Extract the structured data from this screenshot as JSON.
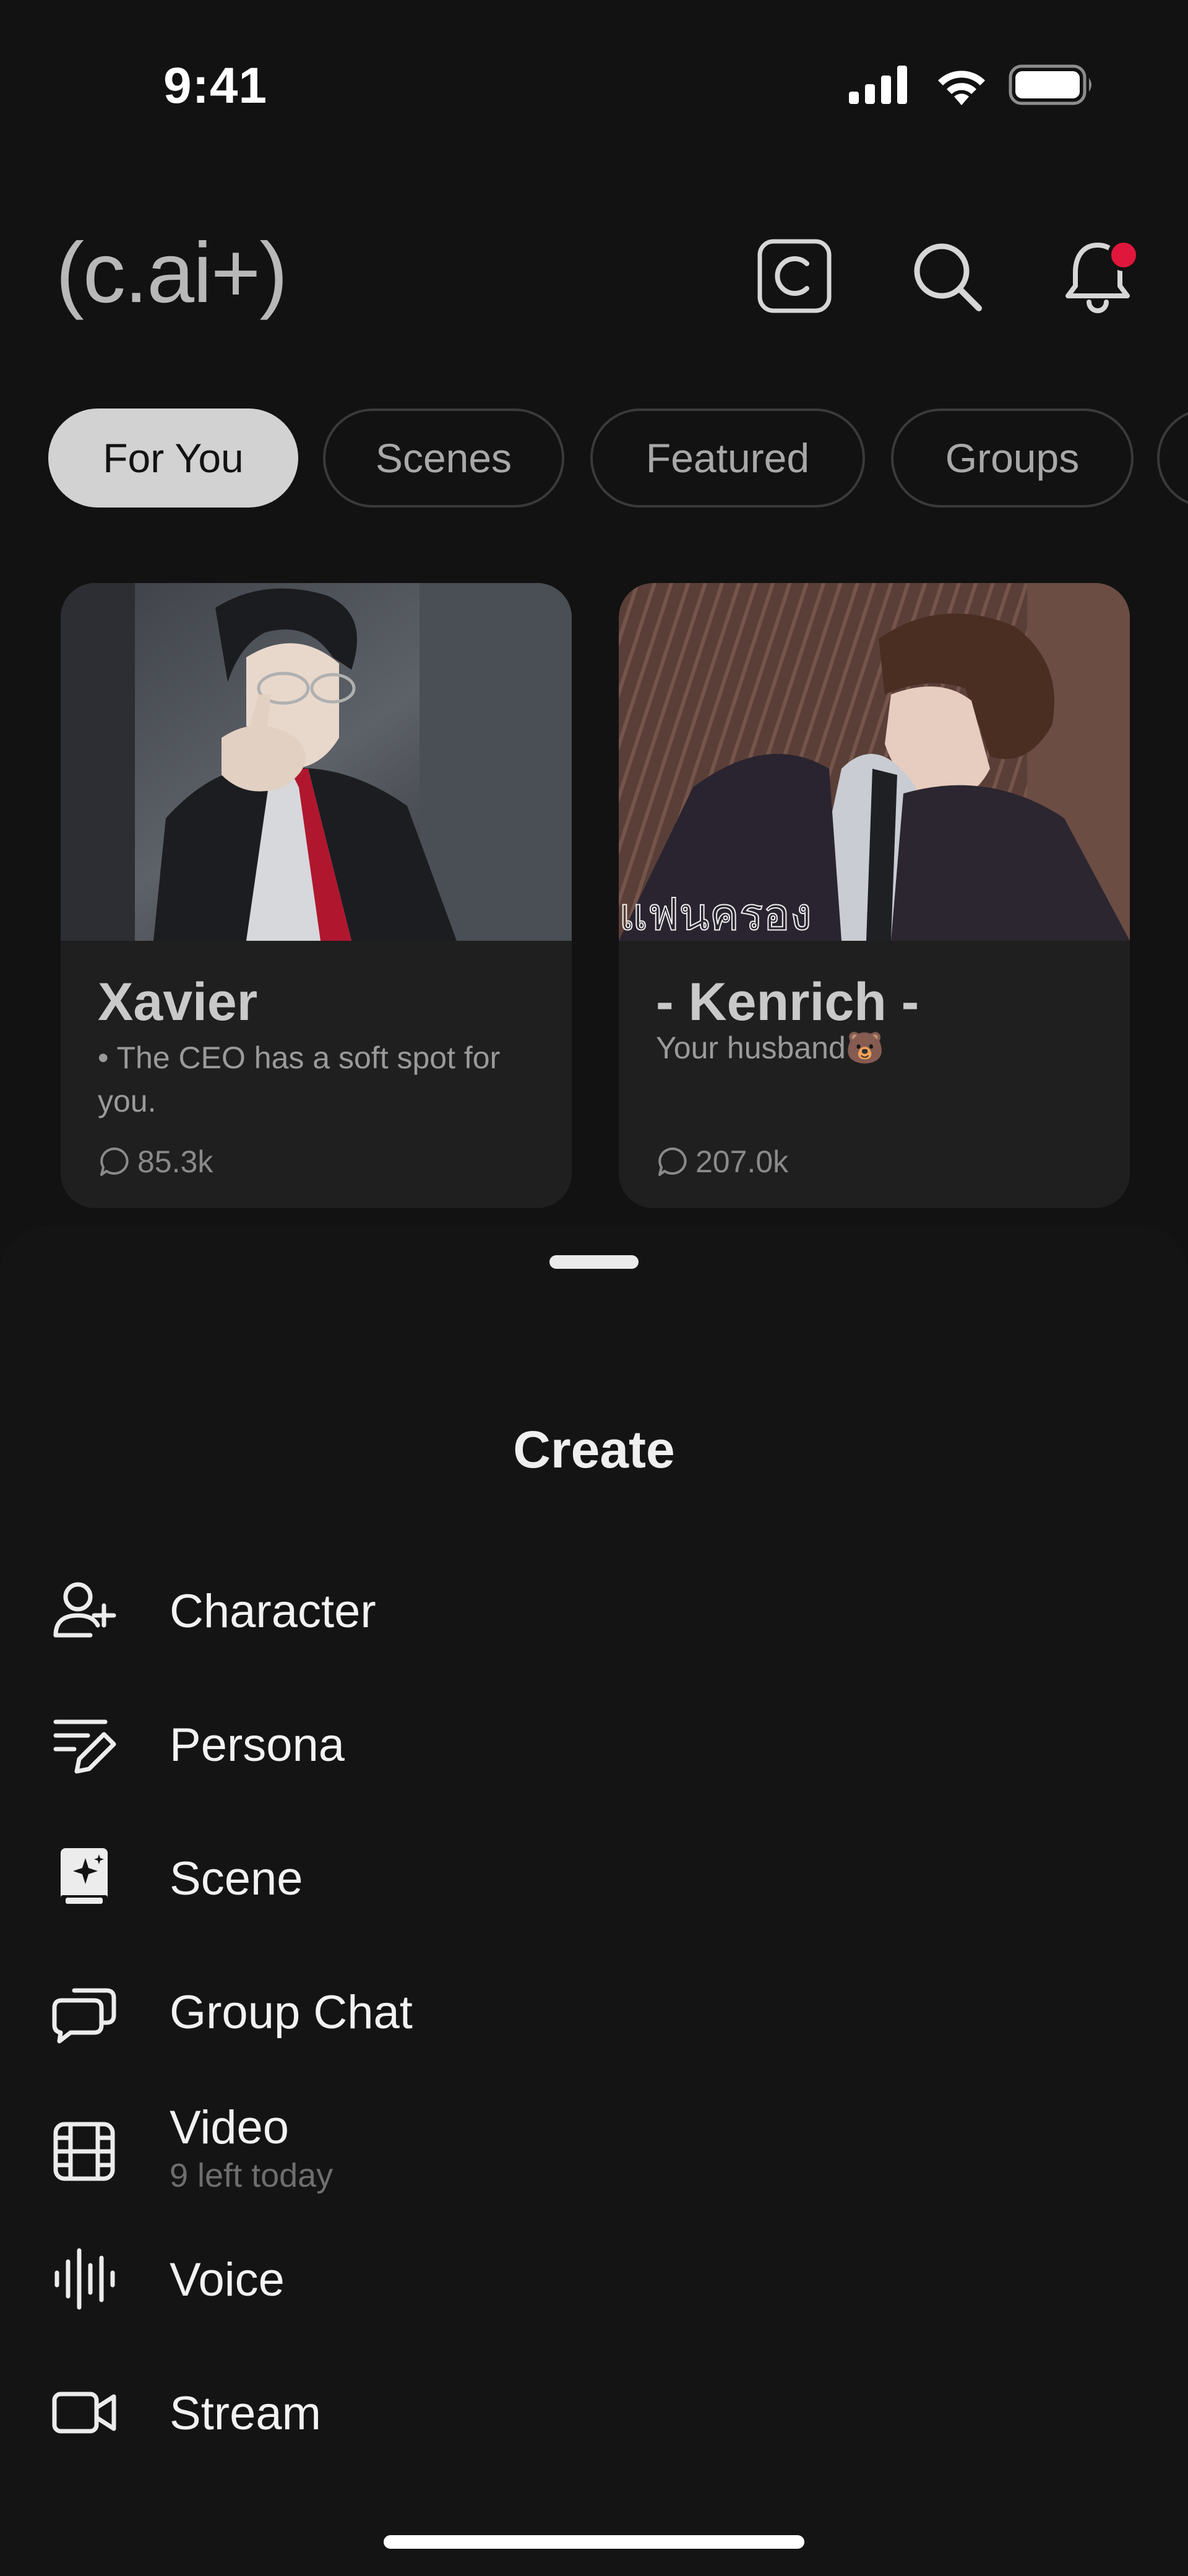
{
  "status_bar": {
    "time": "9:41",
    "icons": [
      "signal-icon",
      "wifi-icon",
      "battery-icon"
    ]
  },
  "header": {
    "logo": "(c.ai+)",
    "buttons": [
      "c-coin-icon",
      "search-icon",
      "bell-icon"
    ],
    "notification_dot_color": "#e0173c"
  },
  "tabs": [
    {
      "label": "For You",
      "active": true
    },
    {
      "label": "Scenes",
      "active": false
    },
    {
      "label": "Featured",
      "active": false
    },
    {
      "label": "Groups",
      "active": false
    }
  ],
  "cards": [
    {
      "name": "Xavier",
      "description": "• The CEO has a soft spot for you.",
      "chats": "85.3k"
    },
    {
      "name": "- Kenrich -",
      "image_text": "แฟนครอง",
      "description": "Your husband🐻",
      "chats": "207.0k"
    }
  ],
  "create_sheet": {
    "title": "Create",
    "items": [
      {
        "label": "Character",
        "icon": "add-user-icon"
      },
      {
        "label": "Persona",
        "icon": "edit-lines-icon"
      },
      {
        "label": "Scene",
        "icon": "sparkle-book-icon"
      },
      {
        "label": "Group Chat",
        "icon": "chat-bubbles-icon"
      },
      {
        "label": "Video",
        "sublabel": "9 left today",
        "icon": "film-icon"
      },
      {
        "label": "Voice",
        "icon": "waveform-icon"
      },
      {
        "label": "Stream",
        "icon": "video-camera-icon"
      }
    ]
  },
  "colors": {
    "background": "#121212",
    "card": "#1f1f1f",
    "active_tab": "#d2d2d2",
    "accent": "#e0173c"
  }
}
